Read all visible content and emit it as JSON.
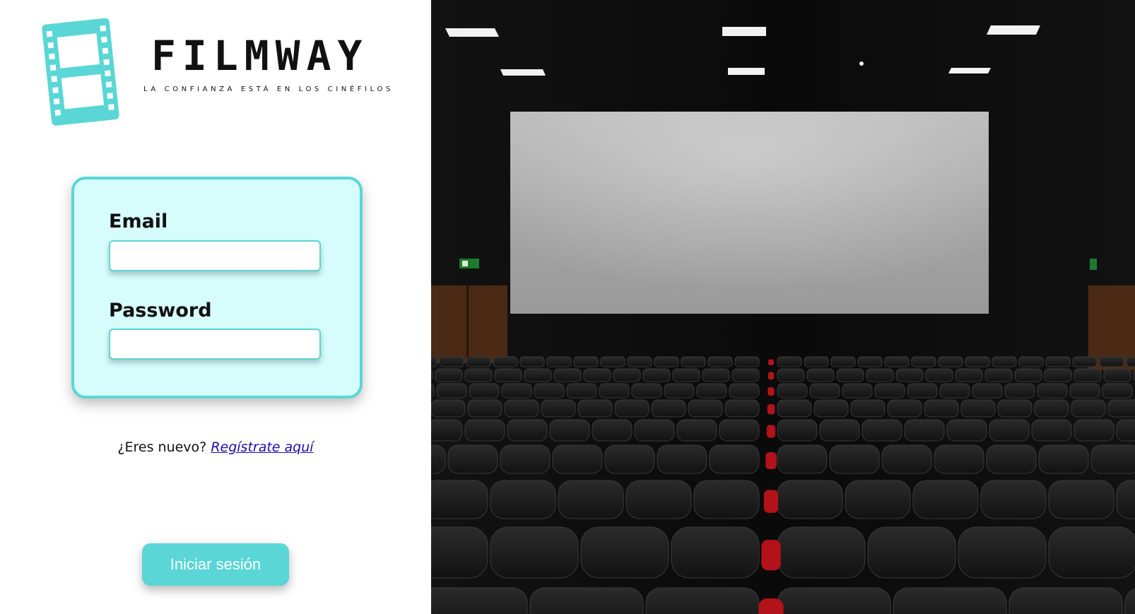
{
  "brand": {
    "name": "FILMWAY",
    "tagline": "LA CONFIANZA ESTÁ EN LOS CINÉFILOS"
  },
  "form": {
    "email_label": "Email",
    "email_value": "",
    "password_label": "Password",
    "password_value": ""
  },
  "register": {
    "prompt": "¿Eres nuevo?",
    "link_text": "Regístrate aquí"
  },
  "login_button_label": "Iniciar sesión",
  "colors": {
    "accent": "#5ad6d6",
    "card_background": "#d6fcfc",
    "link": "#1a0dab"
  },
  "icons": {
    "logo": "film-strip-icon",
    "exit_sign": "exit-sign-icon"
  }
}
